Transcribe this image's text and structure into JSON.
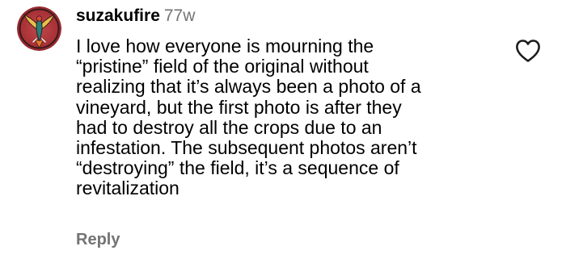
{
  "comment": {
    "username": "suzakufire",
    "age": "77w",
    "body_lines": [
      "I love how everyone is mourning the",
      "“pristine” field of the original without",
      "realizing that it’s always been a photo of a",
      "vineyard, but the first photo is after they",
      "had to destroy all the crops due to an",
      "infestation.  The subsequent photos aren’t",
      "“destroying” the field, it’s a sequence of",
      "revitalization"
    ],
    "reply_label": "Reply",
    "like_icon": "heart-outline-icon",
    "avatar_icon": "phoenix-avatar-icon"
  },
  "colors": {
    "text_primary": "#000000",
    "text_secondary": "#737373",
    "avatar_bg": "#b7363a",
    "avatar_accent": "#e0a23a"
  }
}
